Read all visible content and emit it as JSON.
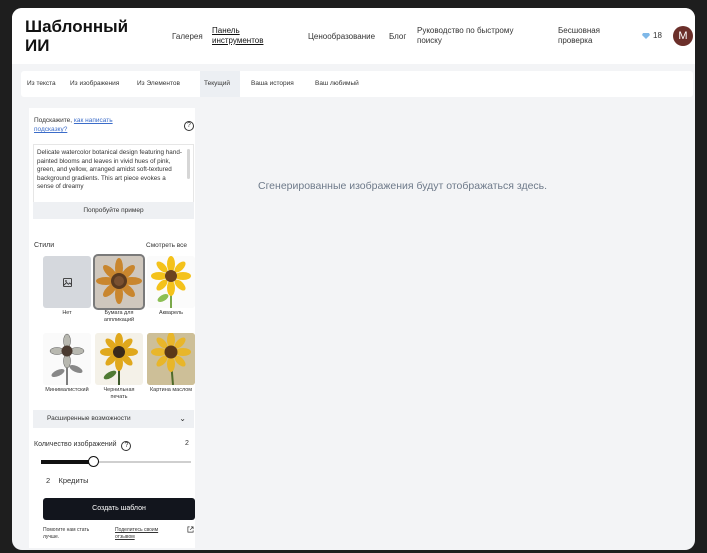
{
  "header": {
    "logo_line1": "Шаблонный",
    "logo_line2": "ИИ",
    "nav": {
      "gallery": "Галерея",
      "dashboard_line1": "Панель",
      "dashboard_line2": "инструментов",
      "pricing": "Ценообразование",
      "blog": "Блог",
      "guide_line1": "Руководство по быстрому",
      "guide_line2": "поиску",
      "free_line1": "Бесшовная",
      "free_line2": "проверка"
    },
    "credits_count": "18",
    "avatar_letter": "M",
    "gem_color": "#7fb8e8"
  },
  "tabs": {
    "from_text": "Из текста",
    "from_image": "Из изображения",
    "from_elements": "Из Элементов",
    "current": "Текущий",
    "history": "Ваша история",
    "favorites": "Ваш любимый"
  },
  "sidebar": {
    "hint_prefix": "Подскажите,",
    "hint_link_line1": "как написать",
    "hint_link_line2": "подсказку?",
    "prompt_text": "Delicate watercolor botanical design featuring hand-painted blooms and leaves in vivid hues of pink, green, and yellow, arranged amidst soft-textured background gradients. This art piece evokes a sense of dreamy",
    "try_example": "Попробуйте пример",
    "styles_title": "Стили",
    "see_all": "Смотреть все",
    "styles": [
      {
        "label": "Нет",
        "icon": "image-icon"
      },
      {
        "label": "Бумага для аппликаций",
        "selected": true
      },
      {
        "label": "Акварель"
      },
      {
        "label": "Минималистский"
      },
      {
        "label": "Чернильная печать"
      },
      {
        "label": "Картина маслом"
      }
    ],
    "advanced": "Расширенные возможности",
    "count_label": "Количество изображений",
    "count_value": "2",
    "count_fraction": 0.35,
    "credit_cost_number": "2",
    "credit_cost_label": "Кредиты",
    "create_button": "Создать шаблон",
    "footer_text": "Помогите нам стать лучше.",
    "footer_link": "Поделитесь своим отзывом"
  },
  "main": {
    "empty_message": "Сгенерированные изображения будут отображаться здесь."
  }
}
